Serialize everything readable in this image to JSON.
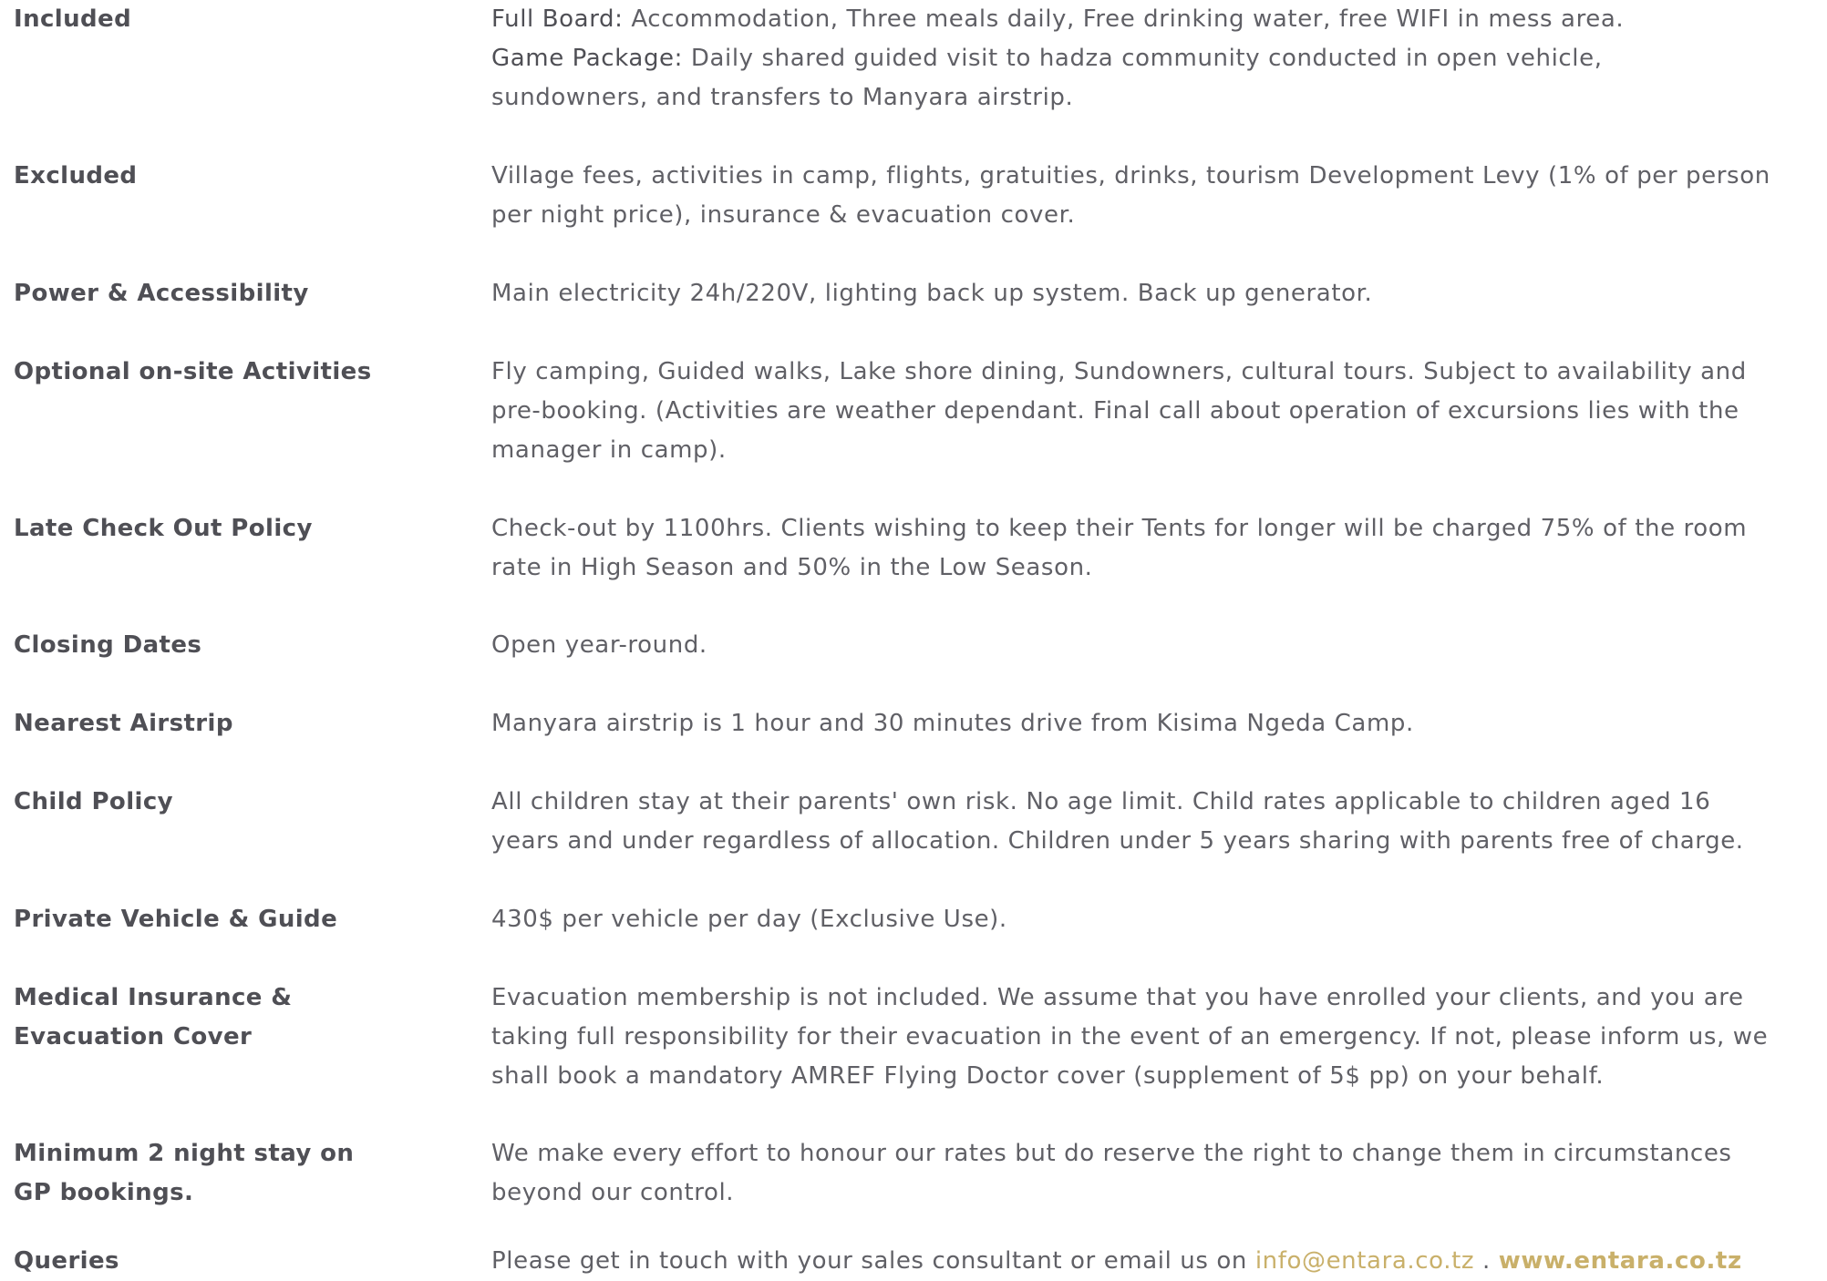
{
  "rows": [
    {
      "label": "Included",
      "lines": [
        {
          "lead": "Full Board:",
          "text": " Accommodation, Three meals daily, Free drinking water, free WIFI in mess area."
        },
        {
          "lead": "Game Package:",
          "text": " Daily shared guided visit to hadza community conducted in open vehicle,"
        },
        {
          "text": "sundowners, and transfers to Manyara airstrip."
        }
      ]
    },
    {
      "label": "Excluded",
      "lines": [
        "Village fees, activities in camp, flights, gratuities, drinks, tourism Development Levy (1% of per person",
        "per night price),  insurance & evacuation cover."
      ]
    },
    {
      "label": "Power & Accessibility",
      "lines": [
        "Main electricity 24h/220V, lighting back up system. Back up generator."
      ]
    },
    {
      "label": "Optional on-site Activities",
      "lines": [
        "Fly camping, Guided walks, Lake shore dining, Sundowners, cultural tours. Subject to availability and",
        "pre-booking. (Activities are weather dependant. Final call about operation of excursions lies with the",
        "manager in camp)."
      ]
    },
    {
      "label": "Late Check Out Policy",
      "lines": [
        "Check-out by 1100hrs. Clients wishing to keep their Tents for longer will be charged 75% of the room",
        "rate in High Season and 50% in the Low Season."
      ]
    },
    {
      "label": "Closing Dates",
      "lines": [
        "Open year-round."
      ]
    },
    {
      "label": "Nearest Airstrip",
      "lines": [
        "Manyara airstrip is 1 hour and 30 minutes drive from Kisima Ngeda Camp."
      ]
    },
    {
      "label": "Child Policy",
      "lines": [
        "All children stay at their parents' own risk. No age limit. Child rates applicable to children aged  16",
        "years and under regardless of allocation. Children under 5 years sharing with parents free of charge."
      ]
    },
    {
      "label": "Private Vehicle & Guide",
      "lines": [
        "430$ per vehicle per day (Exclusive Use)."
      ]
    },
    {
      "label_lines": [
        "Medical Insurance &",
        "Evacuation Cover"
      ],
      "lines": [
        "Evacuation membership is not included. We assume that you have enrolled your clients, and you are",
        "taking full responsibility for their evacuation in the event of an emergency. If not, please inform us, we",
        "shall book a mandatory AMREF Flying Doctor cover (supplement of 5$ pp) on your behalf."
      ]
    },
    {
      "label_lines": [
        "Minimum 2 night stay on",
        "GP bookings."
      ],
      "lines": [
        "We make every effort to honour our rates but do reserve the right to change them in circumstances",
        "beyond our control."
      ]
    },
    {
      "label": "Queries",
      "text": "Please get in touch with your sales consultant or email us on ",
      "email": "info@entara.co.tz",
      "separator": " . ",
      "website": "www.entara.co.tz"
    }
  ],
  "colors": {
    "label": "#4f4f55",
    "text": "#606066",
    "link": "#c9b06a"
  }
}
